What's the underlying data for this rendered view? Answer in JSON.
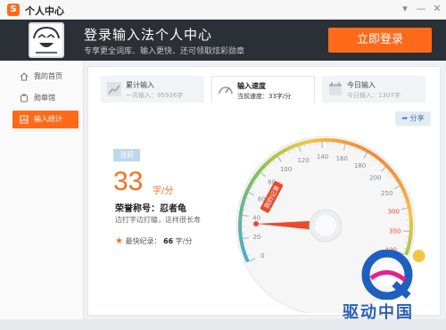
{
  "window": {
    "logo_glyph": "S",
    "title": "个人中心",
    "controls": {
      "menu": "▾",
      "minimize": "—",
      "close": "✕"
    }
  },
  "banner": {
    "title": "登录输入法个人中心",
    "subtitle": "专享更全词库、输入更快、还可领取炫彩勋章",
    "login_label": "立即登录"
  },
  "sidebar": {
    "items": [
      {
        "label": "我的首页",
        "icon": "home-icon",
        "active": false
      },
      {
        "label": "勋章馆",
        "icon": "medal-icon",
        "active": false
      },
      {
        "label": "输入统计",
        "icon": "chart-icon",
        "active": true
      }
    ]
  },
  "tabs": [
    {
      "title": "累计输入",
      "detail": "一共输入：95936字",
      "icon": "bar-chart-icon",
      "active": false
    },
    {
      "title": "输入速度",
      "detail": "当前速度：33字/分",
      "icon": "speedometer-icon",
      "active": true
    },
    {
      "title": "今日输入",
      "detail": "今日输入：1307字",
      "icon": "calendar-icon",
      "active": false
    }
  ],
  "share_label": "分享",
  "stats": {
    "current_badge": "当前",
    "speed": "33",
    "speed_unit": "字/分",
    "honor": "荣誉称号：忍者龟",
    "honor_desc": "边打字边打瞌，这样很长寿",
    "best_label": "最快纪录：",
    "best_value": "66",
    "best_unit": "字/分"
  },
  "gauge": {
    "ticks": [
      "0",
      "20",
      "40",
      "60",
      "80",
      "100",
      "120",
      "140",
      "160",
      "180",
      "200",
      "250",
      "300",
      "350",
      "400"
    ],
    "my_record_label": "我的记录",
    "needle_value": 33,
    "record_value": 66,
    "max": 400
  },
  "watermark": {
    "text": "驱动中国"
  },
  "colors": {
    "accent": "#ff6a1a",
    "banner_bg": "#2b2f36",
    "gauge_blue": "#4aa9d6",
    "gauge_green": "#8bc34a",
    "gauge_red": "#e84a2c"
  }
}
